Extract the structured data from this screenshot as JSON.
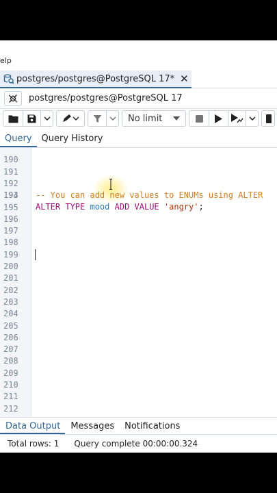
{
  "menu": {
    "help_fragment": "Help"
  },
  "tab": {
    "title": "postgres/postgres@PostgreSQL 17*",
    "close": "✕"
  },
  "connection": {
    "label": "postgres/postgres@PostgreSQL 17"
  },
  "toolbar": {
    "limit": "No limit"
  },
  "subtabs": {
    "query": "Query",
    "history": "Query History"
  },
  "editor": {
    "lines": [
      {
        "n": "190",
        "text": ""
      },
      {
        "n": "191",
        "text": ""
      },
      {
        "n": "192",
        "text": "-- You can add new values to ENUMs using ALTER"
      },
      {
        "n": "193",
        "kw1": "ALTER TYPE",
        "id": "mood",
        "kw2": "ADD VALUE",
        "str": "'angry'",
        "end": ";"
      },
      {
        "n": "194",
        "text": ""
      },
      {
        "n": "195",
        "text": ""
      },
      {
        "n": "196",
        "text": ""
      },
      {
        "n": "197",
        "text": ""
      },
      {
        "n": "198",
        "text": ""
      },
      {
        "n": "199",
        "text": ""
      },
      {
        "n": "200",
        "text": ""
      },
      {
        "n": "201",
        "text": ""
      },
      {
        "n": "202",
        "text": ""
      },
      {
        "n": "203",
        "text": ""
      },
      {
        "n": "204",
        "text": ""
      },
      {
        "n": "205",
        "text": ""
      },
      {
        "n": "206",
        "text": ""
      },
      {
        "n": "207",
        "text": ""
      },
      {
        "n": "208",
        "text": ""
      },
      {
        "n": "209",
        "text": ""
      },
      {
        "n": "210",
        "text": ""
      },
      {
        "n": "211",
        "text": ""
      },
      {
        "n": "212",
        "text": ""
      }
    ]
  },
  "results": {
    "data_output": "Data Output",
    "messages": "Messages",
    "notifications": "Notifications"
  },
  "status": {
    "rows": "Total rows: 1",
    "message": "Query complete 00:00:00.324"
  },
  "colors": {
    "accent": "#326690",
    "comment": "#d08020",
    "keyword": "#a00f78",
    "identifier": "#2c7bb6",
    "string": "#b8360a"
  }
}
